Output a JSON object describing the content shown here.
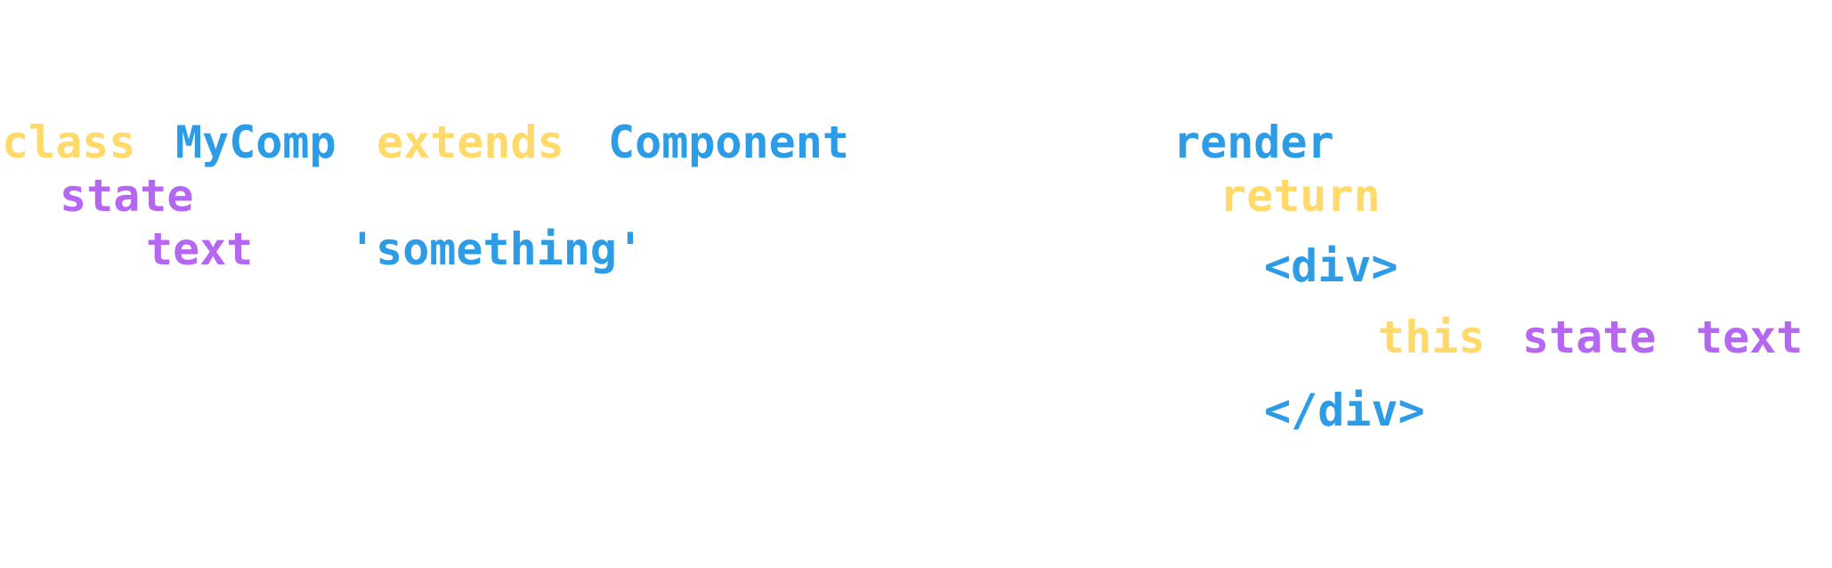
{
  "colors": {
    "keyword": "#FFDA6B",
    "identifier": "#2D9CE6",
    "property": "#B667F1"
  },
  "tokens": {
    "class_kw": "class",
    "class_name": "MyComp",
    "extends_kw": "extends",
    "component_name": "Component",
    "state_prop": "state",
    "text_prop": "text",
    "text_value": "'something'",
    "render_name": "render",
    "return_kw": "return",
    "div_open": "<div>",
    "this_kw": "this",
    "state_ref": "state",
    "text_ref": "text",
    "div_close": "</div>"
  }
}
